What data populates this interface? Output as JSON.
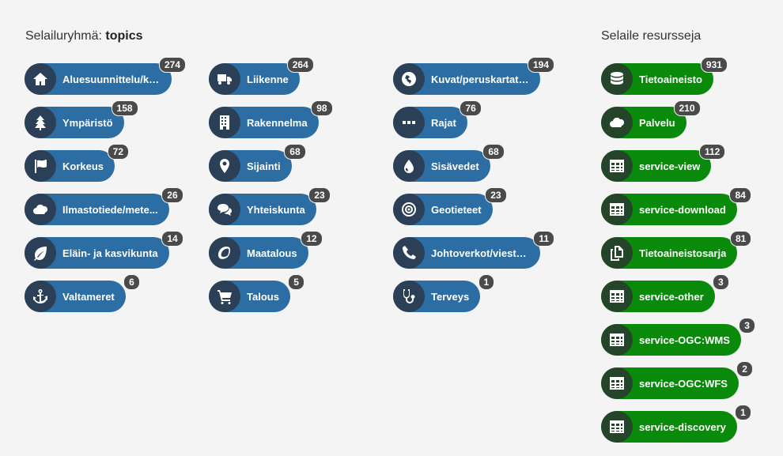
{
  "headings": {
    "topics_prefix": "Selailuryhmä: ",
    "topics_bold": "topics",
    "resources": "Selaile resursseja"
  },
  "colors": {
    "topic_pill": "#2c6da3",
    "resource_pill": "#0a8a0a",
    "badge": "#4a4a4a"
  },
  "topics": {
    "col1": [
      {
        "label": "Aluesuunnittelu/kii...",
        "count": "274",
        "icon": "home-icon"
      },
      {
        "label": "Ympäristö",
        "count": "158",
        "icon": "tree-icon"
      },
      {
        "label": "Korkeus",
        "count": "72",
        "icon": "flag-icon"
      },
      {
        "label": "Ilmastotiede/mete...",
        "count": "26",
        "icon": "cloud-icon"
      },
      {
        "label": "Eläin- ja kasvikunta",
        "count": "14",
        "icon": "leaf-icon"
      },
      {
        "label": "Valtameret",
        "count": "6",
        "icon": "anchor-icon"
      }
    ],
    "col2": [
      {
        "label": "Liikenne",
        "count": "264",
        "icon": "truck-icon"
      },
      {
        "label": "Rakennelma",
        "count": "98",
        "icon": "building-icon"
      },
      {
        "label": "Sijainti",
        "count": "68",
        "icon": "map-marker-icon"
      },
      {
        "label": "Yhteiskunta",
        "count": "23",
        "icon": "comments-icon"
      },
      {
        "label": "Maatalous",
        "count": "12",
        "icon": "lemon-icon"
      },
      {
        "label": "Talous",
        "count": "5",
        "icon": "shopping-cart-icon"
      }
    ],
    "col3": [
      {
        "label": "Kuvat/peruskartat/...",
        "count": "194",
        "icon": "globe-icon"
      },
      {
        "label": "Rajat",
        "count": "76",
        "icon": "ellipsis-icon"
      },
      {
        "label": "Sisävedet",
        "count": "68",
        "icon": "tint-icon"
      },
      {
        "label": "Geotieteet",
        "count": "23",
        "icon": "bullseye-icon"
      },
      {
        "label": "Johtoverkot/viestintä",
        "count": "11",
        "icon": "phone-icon"
      },
      {
        "label": "Terveys",
        "count": "1",
        "icon": "stethoscope-icon"
      }
    ]
  },
  "resources": [
    {
      "label": "Tietoaineisto",
      "count": "931",
      "icon": "database-icon"
    },
    {
      "label": "Palvelu",
      "count": "210",
      "icon": "cloud-icon"
    },
    {
      "label": "service-view",
      "count": "112",
      "icon": "table-icon"
    },
    {
      "label": "service-download",
      "count": "84",
      "icon": "table-icon"
    },
    {
      "label": "Tietoaineistosarja",
      "count": "81",
      "icon": "copy-icon"
    },
    {
      "label": "service-other",
      "count": "3",
      "icon": "table-icon"
    },
    {
      "label": "service-OGC:WMS",
      "count": "3",
      "icon": "table-icon"
    },
    {
      "label": "service-OGC:WFS",
      "count": "2",
      "icon": "table-icon"
    },
    {
      "label": "service-discovery",
      "count": "1",
      "icon": "table-icon"
    }
  ]
}
